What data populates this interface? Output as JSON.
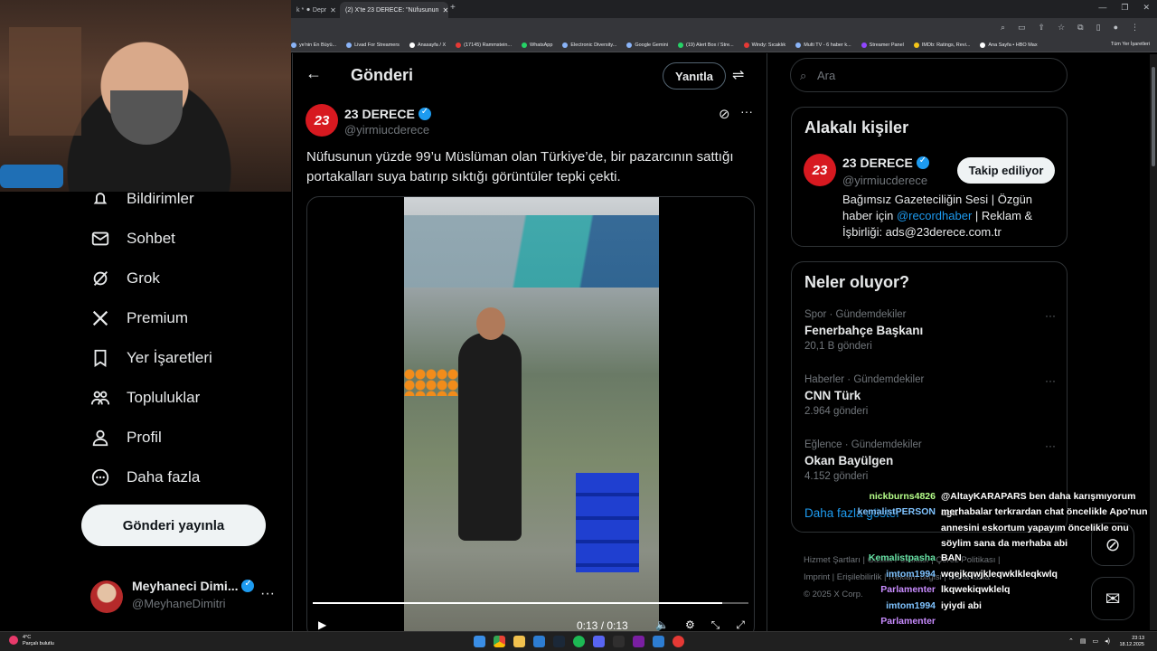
{
  "browser": {
    "tabs": [
      {
        "label": "k * ⚫ Depr"
      },
      {
        "label": "(2) X'te 23 DERECE: \"Nüfusunun"
      }
    ],
    "bookmarks": [
      {
        "label": "ye'nin En Büyü..."
      },
      {
        "label": "Livad For Streamers"
      },
      {
        "label": "Anasayfa / X"
      },
      {
        "label": "(17145) Rammstein..."
      },
      {
        "label": "WhatsApp"
      },
      {
        "label": "Electronic Diversity..."
      },
      {
        "label": "Google Gemini"
      },
      {
        "label": "(19) Alert Box / Stre..."
      },
      {
        "label": "Windy: Sıcaklık"
      },
      {
        "label": "Multi TV - 6 haber k..."
      },
      {
        "label": "Streamer Panel"
      },
      {
        "label": "IMDb: Ratings, Revi..."
      },
      {
        "label": "Ana Sayfa • HBO Max"
      }
    ],
    "all_bookmarks": "Tüm Yer İşaretleri"
  },
  "nav": {
    "items": [
      {
        "label": "Bildirimler",
        "icon": "bell-icon"
      },
      {
        "label": "Sohbet",
        "icon": "mail-icon"
      },
      {
        "label": "Grok",
        "icon": "grok-icon"
      },
      {
        "label": "Premium",
        "icon": "x-logo-icon"
      },
      {
        "label": "Yer İşaretleri",
        "icon": "bookmark-icon"
      },
      {
        "label": "Topluluklar",
        "icon": "people-icon"
      },
      {
        "label": "Profil",
        "icon": "person-icon"
      },
      {
        "label": "Daha fazla",
        "icon": "more-circle-icon"
      }
    ],
    "post_button": "Gönderi yayınla",
    "account": {
      "name": "Meyhaneci Dimi...",
      "handle": "@MeyhaneDimitri"
    }
  },
  "main": {
    "title": "Gönderi",
    "reply_button": "Yanıtla",
    "post": {
      "avatar_text": "23",
      "author": "23 DERECE",
      "handle": "@yirmiucderece",
      "text": "Nüfusunun yüzde 99’u Müslüman olan Türkiye’de, bir pazarcının sattığı portakalları suya batırıp sıktığı görüntüler tepki çekti.",
      "video": {
        "time": "0:13 / 0:13",
        "progress": 0.94
      }
    }
  },
  "right": {
    "search_placeholder": "Ara",
    "related": {
      "title": "Alakalı kişiler",
      "name": "23 DERECE",
      "handle": "@yirmiucderece",
      "follow_label": "Takip ediliyor",
      "bio_a": "Bağımsız Gazeteciliğin Sesi | Özgün haber için ",
      "bio_link": "@recordhaber",
      "bio_b": " | Reklam & İşbirliği: ads@23derece.com.tr"
    },
    "trends": {
      "title": "Neler oluyor?",
      "items": [
        {
          "category": "Spor · Gündemdekiler",
          "title": "Fenerbahçe Başkanı",
          "count": "20,1 B gönderi"
        },
        {
          "category": "Haberler · Gündemdekiler",
          "title": "CNN Türk",
          "count": "2.964 gönderi"
        },
        {
          "category": "Eğlence · Gündemdekiler",
          "title": "Okan Bayülgen",
          "count": "4.152 gönderi"
        }
      ],
      "more": "Daha fazla göster"
    },
    "footer": {
      "line1": "Hizmet Şartları   |   Gizlilik Politikası   |   Çerez Politikası   |",
      "line2": "Imprint   |   Erişilebilirlik   |   Reklam bilgisi   |   Daha fazla ···",
      "line3": "© 2025 X Corp."
    }
  },
  "chat": [
    {
      "user": "nickburns4826",
      "color": "#b6ff8a",
      "text": "@AltayKARAPARS ben daha karışmıyorum aga"
    },
    {
      "user": "kemalistPERSON",
      "color": "#7fc3ff",
      "text": "merhabalar terkrardan chat öncelikle Apo'nun annesini eskortum yapayım öncelikle onu söylim sana da merhaba abi"
    },
    {
      "user": "Kemalistpasha",
      "color": "#66e0a3",
      "text": "BAN"
    },
    {
      "user": "imtom1994",
      "color": "#7fc3ff",
      "text": "wqejkqwjkleqwklkleqkwlq"
    },
    {
      "user": "Parlamenter",
      "color": "#c98cff",
      "text": "lkqwekiqwklelq"
    },
    {
      "user": "imtom1994",
      "color": "#7fc3ff",
      "text": "iyiydi abi"
    },
    {
      "user": "Parlamenter",
      "color": "#c98cff",
      "text": ""
    }
  ],
  "taskbar": {
    "weather_temp": "4°C",
    "weather_desc": "Parçalı bulutlu",
    "time": "23:13",
    "date": "18.12.2025"
  }
}
